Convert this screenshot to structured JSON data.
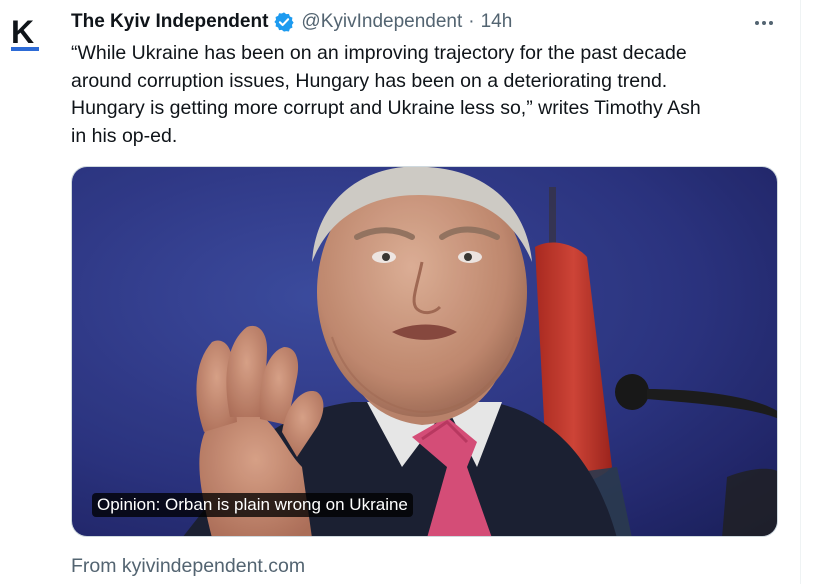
{
  "tweet": {
    "author_name": "The Kyiv Independent",
    "author_handle": "@KyivIndependent",
    "separator": "·",
    "timestamp": "14h",
    "avatar_letter": "K",
    "text": "“While Ukraine has been on an improving trajectory for the past decade\naround corruption issues, Hungary has been on a deteriorating trend.\nHungary is getting more corrupt and Ukraine less so,” writes Timothy Ash\nin his op-ed.",
    "card": {
      "caption": "Opinion: Orban is plain wrong on Ukraine",
      "source": "From kyivindependent.com"
    }
  },
  "icons": {
    "verified": "verified-badge-icon",
    "more": "more-options-icon"
  },
  "colors": {
    "verified": "#1d9bf0",
    "text_primary": "#0f1419",
    "text_secondary": "#536471",
    "brand_bar": "#2d6bd6",
    "flag_red": "#cc3a2d",
    "tie_pink": "#e0527e"
  }
}
